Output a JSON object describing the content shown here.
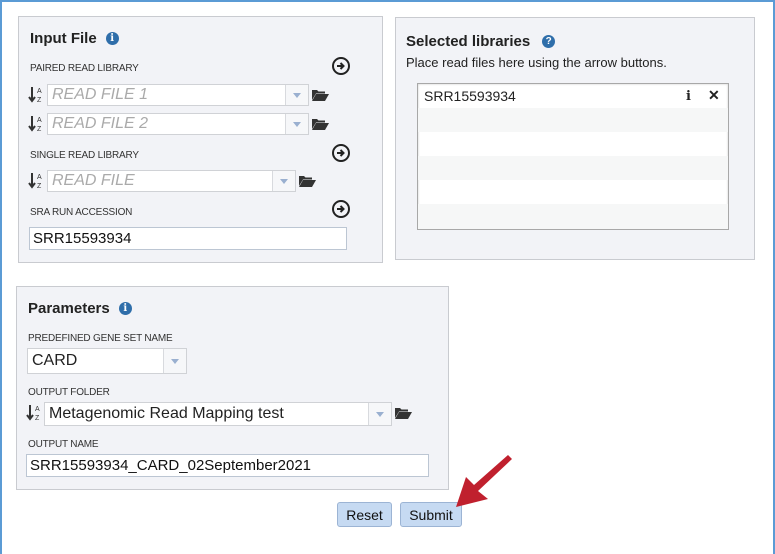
{
  "input_file": {
    "title": "Input File",
    "paired_label": "PAIRED READ LIBRARY",
    "read1_placeholder": "READ FILE 1",
    "read2_placeholder": "READ FILE 2",
    "single_label": "SINGLE READ LIBRARY",
    "single_placeholder": "READ FILE",
    "sra_label": "SRA RUN ACCESSION",
    "sra_value": "SRR15593934"
  },
  "selected_libraries": {
    "title": "Selected libraries",
    "hint": "Place read files here using the arrow buttons.",
    "items": [
      {
        "name": "SRR15593934"
      }
    ]
  },
  "parameters": {
    "title": "Parameters",
    "gene_set_label": "PREDEFINED GENE SET NAME",
    "gene_set_value": "CARD",
    "output_folder_label": "OUTPUT FOLDER",
    "output_folder_value": "Metagenomic Read Mapping test",
    "output_name_label": "OUTPUT NAME",
    "output_name_value": "SRR15593934_CARD_02September2021"
  },
  "actions": {
    "reset": "Reset",
    "submit": "Submit"
  },
  "colors": {
    "button_bg": "#c6daf2",
    "info_icon": "#2f6eaa",
    "annotation_arrow": "#c0202e"
  }
}
